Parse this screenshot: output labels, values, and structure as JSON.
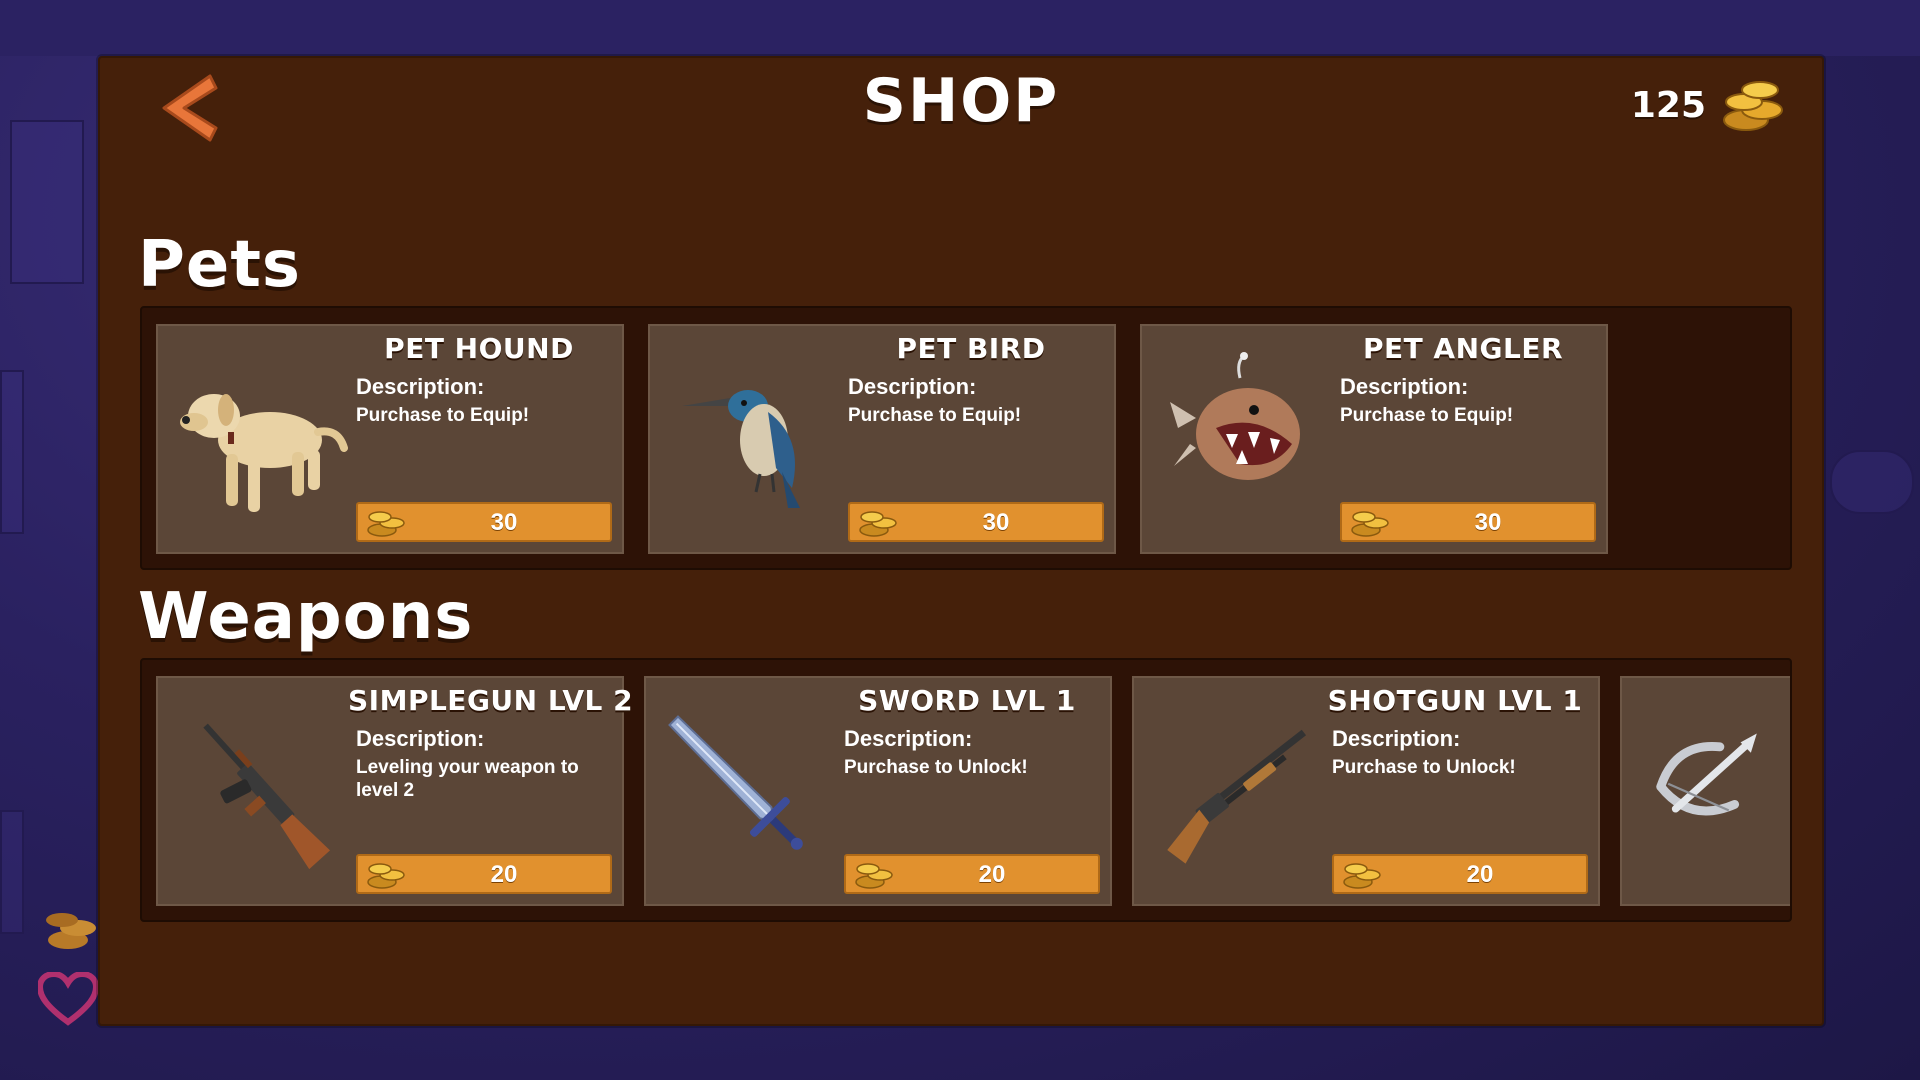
{
  "header": {
    "title": "SHOP",
    "coin_balance": "125",
    "back_icon": "chevron-left-icon",
    "coin_icon": "coin-stack-icon"
  },
  "colors": {
    "panel": "#45200a",
    "shelf": "#2d1206",
    "card": "#5b4637",
    "buy_button": "#e1912e",
    "back_arrow": "#e8763a"
  },
  "pets": {
    "title": "Pets",
    "items": [
      {
        "name": "Pet Hound",
        "desc_label": "Description:",
        "desc": "Purchase to Equip!",
        "price": "30",
        "icon": "dog-icon"
      },
      {
        "name": "Pet Bird",
        "desc_label": "Description:",
        "desc": "Purchase to Equip!",
        "price": "30",
        "icon": "bird-icon"
      },
      {
        "name": "Pet Angler",
        "desc_label": "Description:",
        "desc": "Purchase to Equip!",
        "price": "30",
        "icon": "anglerfish-icon"
      }
    ]
  },
  "weapons": {
    "title": "Weapons",
    "items": [
      {
        "name": "SimpleGun LVL 2",
        "desc_label": "Description:",
        "desc": "Leveling your weapon to level 2",
        "price": "20",
        "icon": "rifle-icon"
      },
      {
        "name": "Sword LVL 1",
        "desc_label": "Description:",
        "desc": "Purchase to Unlock!",
        "price": "20",
        "icon": "sword-icon"
      },
      {
        "name": "Shotgun LVL 1",
        "desc_label": "Description:",
        "desc": "Purchase to Unlock!",
        "price": "20",
        "icon": "shotgun-icon"
      },
      {
        "icon": "crossbow-icon"
      }
    ]
  }
}
